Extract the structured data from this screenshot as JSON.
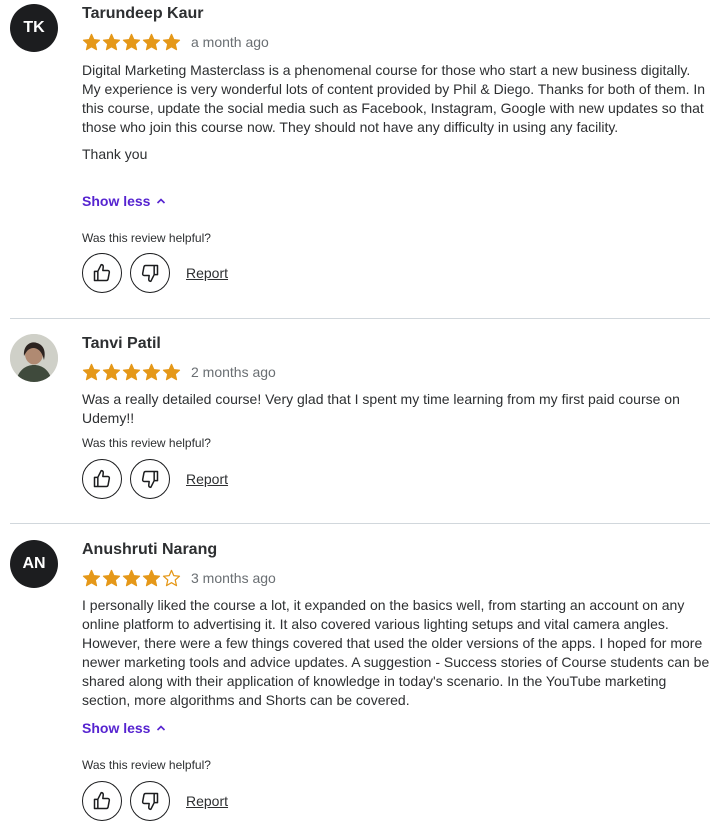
{
  "reviews": [
    {
      "initials": "TK",
      "name": "Tarundeep Kaur",
      "rating": 5,
      "date": "a month ago",
      "paragraphs": [
        "Digital Marketing Masterclass is a phenomenal course for those who start a new business digitally. My experience is very wonderful lots of content provided by Phil & Diego. Thanks for both of them. In this course, update the social media such as Facebook, Instagram, Google with new updates so that those who join this course now. They should not have any difficulty in using any facility.",
        "Thank you"
      ],
      "show_less": "Show less",
      "helpful_question": "Was this review helpful?",
      "report": "Report"
    },
    {
      "initials": "",
      "name": "Tanvi Patil",
      "rating": 5,
      "date": "2 months ago",
      "paragraphs": [
        "Was a really detailed course! Very glad that I spent my time learning from my first paid course on Udemy!!"
      ],
      "helpful_question": "Was this review helpful?",
      "report": "Report"
    },
    {
      "initials": "AN",
      "name": "Anushruti Narang",
      "rating": 4,
      "date": "3 months ago",
      "paragraphs": [
        "I personally liked the course a lot, it expanded on the basics well, from starting an account on any online platform to advertising it. It also covered various lighting setups and vital camera angles. However, there were a few things covered that used the older versions of the apps. I hoped for more newer marketing tools and advice updates. A suggestion - Success stories of Course students can be shared along with their application of knowledge in today's scenario. In the YouTube marketing section, more algorithms and Shorts can be covered."
      ],
      "show_less": "Show less",
      "helpful_question": "Was this review helpful?",
      "report": "Report"
    }
  ],
  "icons": {
    "star_color": "#e59819",
    "star_filled": "star-filled-icon",
    "star_empty": "star-outline-icon",
    "thumbs_up": "thumbs-up-icon",
    "thumbs_down": "thumbs-down-icon",
    "chevron": "chevron-up-icon"
  },
  "colors": {
    "accent": "#5624d0",
    "avatar_bg": "#1c1d1f",
    "divider": "#d1d7dc"
  }
}
